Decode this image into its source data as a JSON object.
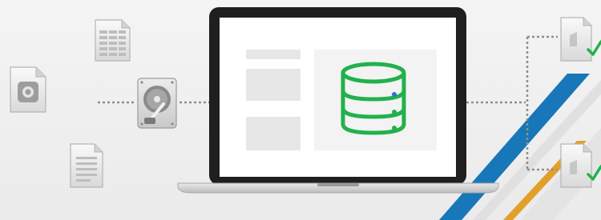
{
  "illustration": {
    "scene": "data-backup-to-laptop-database",
    "icons": {
      "image_file": "image-file-icon",
      "spreadsheet_file": "spreadsheet-file-icon",
      "text_file": "text-document-icon",
      "hard_drive": "hard-drive-icon",
      "laptop": "laptop-icon",
      "database": "database-icon",
      "verified_file_top": "verified-file-icon",
      "verified_file_bottom": "verified-file-icon"
    },
    "colors": {
      "background": "#f1f1f1",
      "laptop_bezel": "#1f1f1f",
      "screen": "#ffffff",
      "placeholder_block": "#e6e6e6",
      "db_panel": "#f3f3f3",
      "db_green": "#22b14c",
      "db_dot_blue": "#2f6fd6",
      "connector_gray": "#8f8f8f",
      "checkmark_green": "#22b14c",
      "stripe_blue": "#1777b8",
      "stripe_orange": "#e2a02a",
      "stripe_light": "#e3e3e3"
    }
  }
}
